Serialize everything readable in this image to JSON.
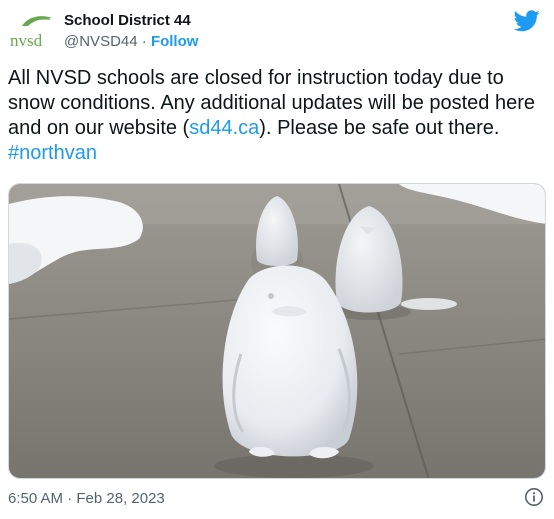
{
  "account": {
    "display_name": "School District 44",
    "handle": "@NVSD44",
    "separator": " · ",
    "follow_label": "Follow",
    "logo_text": "nvsd"
  },
  "tweet": {
    "text_part1": "All NVSD schools are closed for instruction today due to snow conditions. Any additional updates will be posted here and on our website (",
    "link_text": "sd44.ca",
    "text_part2": "). Please be safe out there. ",
    "hashtag": "#northvan"
  },
  "media": {
    "description_icon": "photo"
  },
  "footer": {
    "timestamp": "6:50 AM · Feb 28, 2023",
    "info_icon": "info-icon"
  },
  "colors": {
    "accent": "#1d9bf0",
    "text": "#0f1419",
    "secondary": "#536471",
    "logo_green": "#6aa84f"
  }
}
